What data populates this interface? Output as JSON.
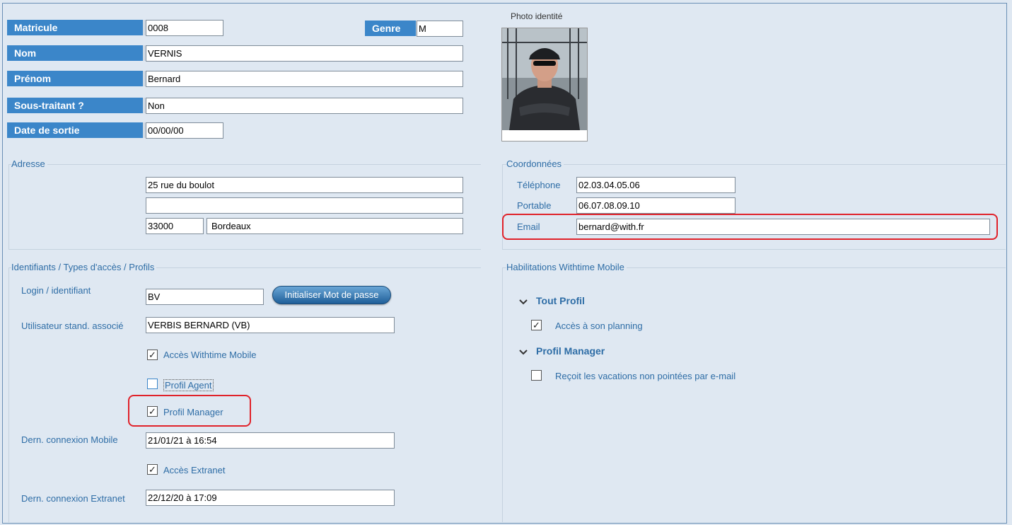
{
  "identity": {
    "matricule_label": "Matricule",
    "matricule_value": "0008",
    "genre_label": "Genre",
    "genre_value": "M",
    "nom_label": "Nom",
    "nom_value": "VERNIS",
    "prenom_label": "Prénom",
    "prenom_value": "Bernard",
    "sous_traitant_label": "Sous-traitant ?",
    "sous_traitant_value": "Non",
    "date_sortie_label": "Date de sortie",
    "date_sortie_value": "00/00/00"
  },
  "photo": {
    "label": "Photo identité"
  },
  "adresse": {
    "title": "Adresse",
    "line1": "25 rue du boulot",
    "line2": "",
    "postal_code": "33000",
    "city": "Bordeaux"
  },
  "coordonnees": {
    "title": "Coordonnées",
    "telephone_label": "Téléphone",
    "telephone_value": "02.03.04.05.06",
    "portable_label": "Portable",
    "portable_value": "06.07.08.09.10",
    "email_label": "Email",
    "email_value": "bernard@with.fr"
  },
  "access": {
    "title": "Identifiants / Types d'accès / Profils",
    "login_label": "Login / identifiant",
    "login_value": "BV",
    "init_password_button": "Initialiser Mot de passe",
    "user_std_label": "Utilisateur stand. associé",
    "user_std_value": "VERBIS BERNARD (VB)",
    "acces_mobile_label": "Accès Withtime Mobile",
    "acces_mobile_checked": true,
    "profil_agent_label": "Profil Agent",
    "profil_agent_checked": false,
    "profil_manager_label": "Profil Manager",
    "profil_manager_checked": true,
    "dern_mobile_label": "Dern. connexion Mobile",
    "dern_mobile_value": "21/01/21 à 16:54",
    "acces_extranet_label": "Accès Extranet",
    "acces_extranet_checked": true,
    "dern_extranet_label": "Dern. connexion Extranet",
    "dern_extranet_value": "22/12/20 à 17:09"
  },
  "habilitations": {
    "title": "Habilitations Withtime Mobile",
    "sections": [
      {
        "title": "Tout Profil",
        "items": [
          {
            "label": "Accès à son planning",
            "checked": true
          }
        ]
      },
      {
        "title": "Profil Manager",
        "items": [
          {
            "label": "Reçoit les vacations non pointées par e-mail",
            "checked": false
          }
        ]
      }
    ]
  },
  "icons": {
    "chevron": "chevron-down-icon",
    "check": "checkmark-icon"
  },
  "colors": {
    "label_bg": "#3b86c9",
    "accent_text": "#2e6da6",
    "highlight": "#e0222a",
    "background": "#dfe8f2"
  }
}
